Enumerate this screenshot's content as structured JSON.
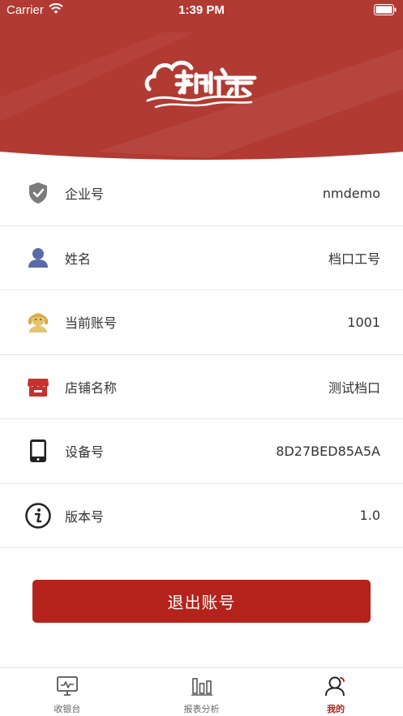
{
  "status_bar": {
    "carrier": "Carrier",
    "time": "1:39 PM"
  },
  "header": {
    "logo_icon": "cloud-store-logo"
  },
  "info_rows": [
    {
      "icon": "shield-check-icon",
      "label": "企业号",
      "value": "nmdemo"
    },
    {
      "icon": "person-icon",
      "label": "姓名",
      "value": "档口工号"
    },
    {
      "icon": "headset-user-icon",
      "label": "当前账号",
      "value": "1001"
    },
    {
      "icon": "store-icon",
      "label": "店铺名称",
      "value": "测试档口"
    },
    {
      "icon": "phone-icon",
      "label": "设备号",
      "value": "8D27BED85A5A"
    },
    {
      "icon": "info-icon",
      "label": "版本号",
      "value": "1.0"
    }
  ],
  "logout_label": "退出账号",
  "tabbar": {
    "tabs": [
      {
        "label": "收银台",
        "icon": "monitor-icon",
        "active": false
      },
      {
        "label": "报表分析",
        "icon": "bar-chart-icon",
        "active": false
      },
      {
        "label": "我的",
        "icon": "user-icon",
        "active": true
      }
    ]
  },
  "colors": {
    "brand_red": "#b3231b",
    "header_red": "#b13a32"
  }
}
